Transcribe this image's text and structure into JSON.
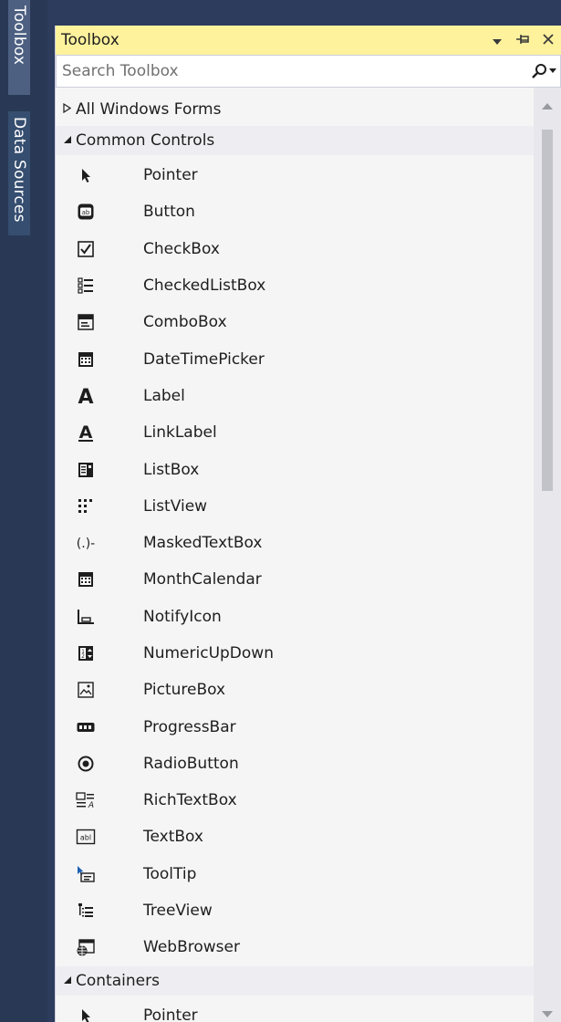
{
  "dock": {
    "tabs": [
      {
        "label": "Toolbox",
        "active": true
      },
      {
        "label": "Data Sources",
        "active": false
      }
    ]
  },
  "window": {
    "title": "Toolbox",
    "buttons": [
      "dropdown",
      "pin",
      "close"
    ],
    "accent_color": "#fff29d"
  },
  "search": {
    "placeholder": "Search Toolbox",
    "value": ""
  },
  "groups": {
    "all_windows_forms": {
      "label": "All Windows Forms",
      "expanded": false
    },
    "common_controls": {
      "label": "Common Controls",
      "expanded": true
    },
    "containers": {
      "label": "Containers",
      "expanded": true
    }
  },
  "common_controls": [
    {
      "label": "Pointer",
      "icon": "pointer-icon"
    },
    {
      "label": "Button",
      "icon": "button-icon"
    },
    {
      "label": "CheckBox",
      "icon": "checkbox-icon"
    },
    {
      "label": "CheckedListBox",
      "icon": "checkedlistbox-icon"
    },
    {
      "label": "ComboBox",
      "icon": "combobox-icon"
    },
    {
      "label": "DateTimePicker",
      "icon": "datetimepicker-icon"
    },
    {
      "label": "Label",
      "icon": "label-icon"
    },
    {
      "label": "LinkLabel",
      "icon": "linklabel-icon"
    },
    {
      "label": "ListBox",
      "icon": "listbox-icon"
    },
    {
      "label": "ListView",
      "icon": "listview-icon"
    },
    {
      "label": "MaskedTextBox",
      "icon": "maskedtextbox-icon"
    },
    {
      "label": "MonthCalendar",
      "icon": "monthcalendar-icon"
    },
    {
      "label": "NotifyIcon",
      "icon": "notifyicon-icon"
    },
    {
      "label": "NumericUpDown",
      "icon": "numericupdown-icon"
    },
    {
      "label": "PictureBox",
      "icon": "picturebox-icon"
    },
    {
      "label": "ProgressBar",
      "icon": "progressbar-icon"
    },
    {
      "label": "RadioButton",
      "icon": "radiobutton-icon"
    },
    {
      "label": "RichTextBox",
      "icon": "richtextbox-icon"
    },
    {
      "label": "TextBox",
      "icon": "textbox-icon"
    },
    {
      "label": "ToolTip",
      "icon": "tooltip-icon"
    },
    {
      "label": "TreeView",
      "icon": "treeview-icon"
    },
    {
      "label": "WebBrowser",
      "icon": "webbrowser-icon"
    }
  ],
  "containers": [
    {
      "label": "Pointer",
      "icon": "pointer-icon"
    }
  ]
}
